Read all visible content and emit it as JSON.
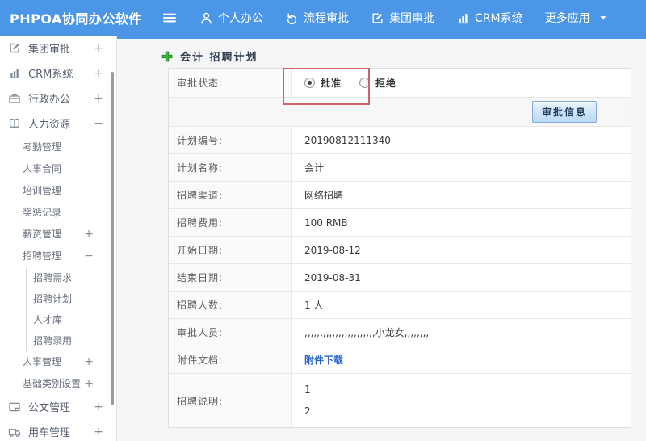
{
  "topbar": {
    "logo": "PHPOA协同办公软件",
    "menu_icon": "hamburger-icon",
    "nav": [
      {
        "id": "personal-office",
        "icon": "person-icon",
        "label": "个人办公"
      },
      {
        "id": "workflow-approval",
        "icon": "history-icon",
        "label": "流程审批"
      },
      {
        "id": "group-approval",
        "icon": "edit-square-icon",
        "label": "集团审批"
      },
      {
        "id": "crm-system",
        "icon": "bar-chart-icon",
        "label": "CRM系统"
      },
      {
        "id": "more-apps",
        "label": "更多应用",
        "trailing_icon": "caret-down-icon"
      }
    ],
    "colors": {
      "background": "#4b96e6",
      "text": "#ffffff"
    }
  },
  "sidebar": {
    "items": [
      {
        "id": "group-approval",
        "level": 0,
        "icon": "edit-square-icon",
        "label": "集团审批",
        "expander": "+"
      },
      {
        "id": "crm-system",
        "level": 0,
        "icon": "bar-chart-icon",
        "label": "CRM系统",
        "expander": "+"
      },
      {
        "id": "admin-office",
        "level": 0,
        "icon": "briefcase-icon",
        "label": "行政办公",
        "expander": "+"
      },
      {
        "id": "human-resources",
        "level": 0,
        "icon": "book-icon",
        "label": "人力资源",
        "expander": "-"
      },
      {
        "id": "attendance",
        "level": 1,
        "label": "考勤管理"
      },
      {
        "id": "hr-contract",
        "level": 1,
        "label": "人事合同"
      },
      {
        "id": "training",
        "level": 1,
        "label": "培训管理"
      },
      {
        "id": "rewards",
        "level": 1,
        "label": "奖惩记录"
      },
      {
        "id": "salary",
        "level": 1,
        "label": "薪资管理",
        "expander": "+"
      },
      {
        "id": "recruitment",
        "level": 1,
        "label": "招聘管理",
        "expander": "-"
      },
      {
        "id": "recruit-demand",
        "level": 2,
        "label": "招聘需求"
      },
      {
        "id": "recruit-plan",
        "level": 2,
        "label": "招聘计划"
      },
      {
        "id": "talent-pool",
        "level": 2,
        "label": "人才库"
      },
      {
        "id": "recruit-hire",
        "level": 2,
        "label": "招聘录用"
      },
      {
        "id": "personnel",
        "level": 1,
        "label": "人事管理",
        "expander": "+"
      },
      {
        "id": "base-category",
        "level": 1,
        "label": "基础类别设置",
        "expander": "+"
      },
      {
        "id": "document-mgmt",
        "level": 0,
        "icon": "document-icon",
        "label": "公文管理",
        "expander": "+"
      },
      {
        "id": "vehicle-mgmt",
        "level": 0,
        "icon": "truck-icon",
        "label": "用车管理",
        "expander": "+"
      }
    ]
  },
  "main": {
    "title": {
      "prefix_icon": "plus-icon",
      "text": "会计 招聘计划"
    },
    "approval_button": "审批信息",
    "form": {
      "status_label": "审批状态:",
      "radios": [
        {
          "id": "approve",
          "label": "批准",
          "checked": true
        },
        {
          "id": "reject",
          "label": "拒绝",
          "checked": false
        }
      ],
      "rows": [
        {
          "label": "计划编号:",
          "value": "20190812111340"
        },
        {
          "label": "计划名称:",
          "value": "会计"
        },
        {
          "label": "招聘渠道:",
          "value": "网络招聘"
        },
        {
          "label": "招聘费用:",
          "value": "100 RMB"
        },
        {
          "label": "开始日期:",
          "value": "2019-08-12"
        },
        {
          "label": "结束日期:",
          "value": "2019-08-31"
        },
        {
          "label": "招聘人数:",
          "value": "1 人"
        },
        {
          "label": "审批人员:",
          "value": ",,,,,,,,,,,,,,,,,,,,,,,小龙女,,,,,,,,"
        },
        {
          "label": "附件文档:",
          "value": "附件下载",
          "link": true
        },
        {
          "label": "招聘说明:",
          "lines": [
            "1",
            "2"
          ]
        }
      ]
    },
    "colors": {
      "highlight_box": "#c9646c",
      "link": "#2a66c8",
      "title_plus": "#3cb43c"
    }
  }
}
